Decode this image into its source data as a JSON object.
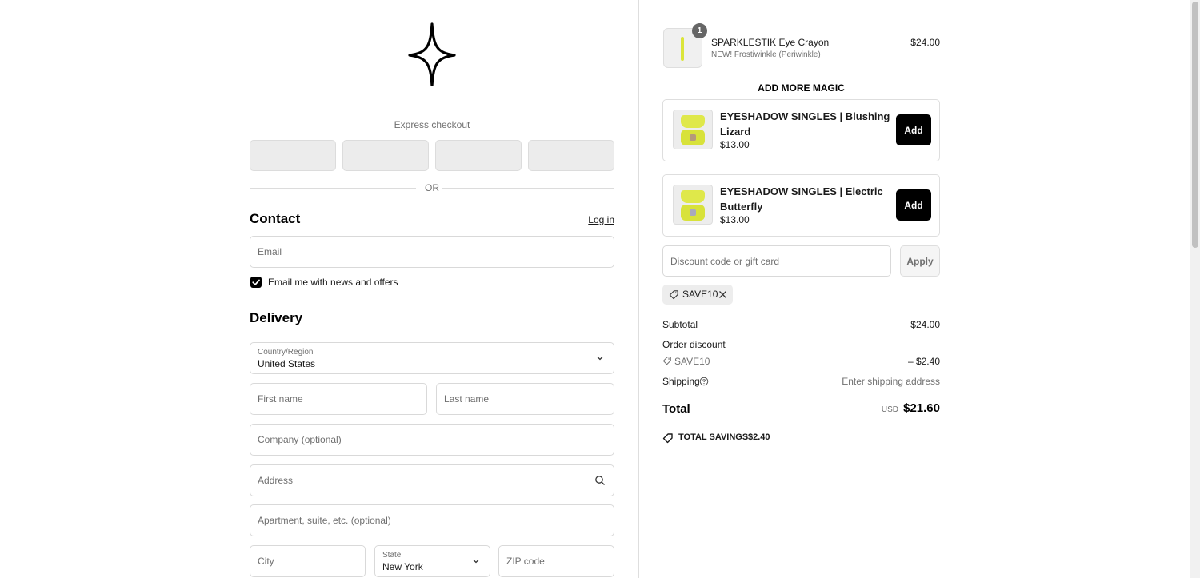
{
  "express": {
    "label": "Express checkout",
    "or": "OR"
  },
  "contact": {
    "heading": "Contact",
    "login": "Log in",
    "email_placeholder": "Email",
    "newsletter_label": "Email me with news and offers",
    "newsletter_checked": true
  },
  "delivery": {
    "heading": "Delivery",
    "country_label": "Country/Region",
    "country_value": "United States",
    "first_name": "First name",
    "last_name": "Last name",
    "company": "Company (optional)",
    "address": "Address",
    "apartment": "Apartment, suite, etc. (optional)",
    "city": "City",
    "state_label": "State",
    "state_value": "New York",
    "zip": "ZIP code"
  },
  "cart": {
    "item": {
      "quantity": "1",
      "name": "SPARKLESTIK Eye Crayon",
      "variant": "NEW! Frostiwinkle (Periwinkle)",
      "price": "$24.00"
    },
    "upsell_title": "ADD MORE MAGIC",
    "upsells": [
      {
        "name": "EYESHADOW SINGLES | Blushing Lizard",
        "price": "$13.00",
        "button": "Add",
        "pan_color": "#b59a7a"
      },
      {
        "name": "EYESHADOW SINGLES | Electric Butterfly",
        "price": "$13.00",
        "button": "Add",
        "pan_color": "#a9a9bd"
      }
    ],
    "discount_placeholder": "Discount code or gift card",
    "apply": "Apply",
    "applied_code": "SAVE10",
    "summary": {
      "subtotal_label": "Subtotal",
      "subtotal": "$24.00",
      "order_discount_label": "Order discount",
      "discount_code": "SAVE10",
      "discount_value": "– $2.40",
      "shipping_label": "Shipping",
      "shipping_value": "Enter shipping address",
      "total_label": "Total",
      "currency": "USD",
      "total": "$21.60",
      "savings_label": "TOTAL SAVINGS",
      "savings_value": "$2.40"
    }
  }
}
